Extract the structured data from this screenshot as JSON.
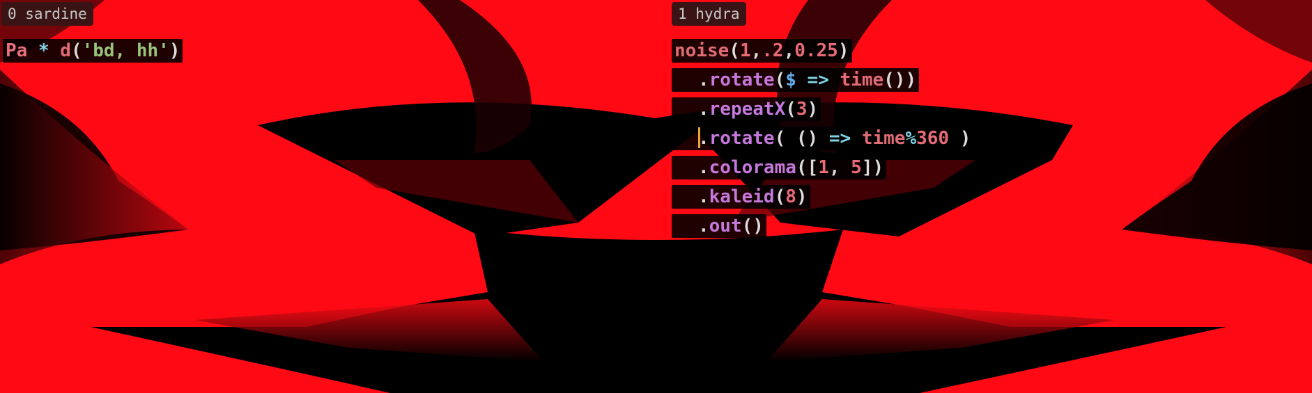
{
  "panes": [
    {
      "tab": "0 sardine",
      "code_lines": [
        "Pa * d('bd, hh')"
      ]
    },
    {
      "tab": "1 hydra",
      "code_lines": [
        "noise(1,.2,0.25)",
        "  .rotate($ => time())",
        "  .repeatX(3)",
        "  .rotate( () => time%360 )",
        "  .colorama([1, 5])",
        "  .kaleid(8)",
        "  .out()"
      ]
    }
  ],
  "colors": {
    "background_red": "#ff0a14",
    "background_dark": "#000000",
    "tab_bg": "#3a1414",
    "cursor": "#e8a53a"
  }
}
